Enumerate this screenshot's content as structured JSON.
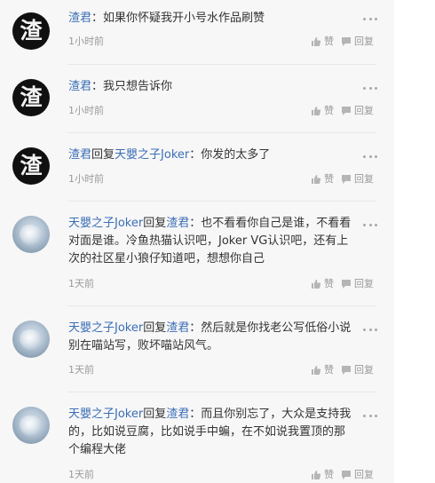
{
  "comments": [
    {
      "avatar_glyph": "渣",
      "author": "渣君",
      "reply_word": "",
      "reply_to": "",
      "separator": "：",
      "text": "如果你怀疑我开小号水作品刷赞",
      "time": "1小时前",
      "like": "赞",
      "reply": "回复",
      "avatar_style": "dark"
    },
    {
      "avatar_glyph": "渣",
      "author": "渣君",
      "reply_word": "",
      "reply_to": "",
      "separator": "：",
      "text": "我只想告诉你",
      "time": "1小时前",
      "like": "赞",
      "reply": "回复",
      "avatar_style": "dark"
    },
    {
      "avatar_glyph": "渣",
      "author": "渣君",
      "reply_word": "回复",
      "reply_to": "天嬰之子Joker",
      "separator": "：",
      "text": "你发的太多了",
      "time": "1小时前",
      "like": "赞",
      "reply": "回复",
      "avatar_style": "dark"
    },
    {
      "avatar_glyph": "",
      "author": "天嬰之子Joker",
      "reply_word": "回复",
      "reply_to": "渣君",
      "separator": "：",
      "text": "也不看看你自己是谁，不看看对面是谁。冷鱼热猫认识吧，Joker VG认识吧，还有上次的社区星小狼仔知道吧，想想你自己",
      "time": "1天前",
      "like": "赞",
      "reply": "回复",
      "avatar_style": "light"
    },
    {
      "avatar_glyph": "",
      "author": "天嬰之子Joker",
      "reply_word": "回复",
      "reply_to": "渣君",
      "separator": "：",
      "text": "然后就是你找老公写低俗小说别在喵站写，败坏喵站风气。",
      "time": "1天前",
      "like": "赞",
      "reply": "回复",
      "avatar_style": "light"
    },
    {
      "avatar_glyph": "",
      "author": "天嬰之子Joker",
      "reply_word": "回复",
      "reply_to": "渣君",
      "separator": "：",
      "text": "而且你别忘了，大众是支持我的，比如说豆腐，比如说手中蝙，在不如说我置顶的那个编程大佬",
      "time": "1天前",
      "like": "赞",
      "reply": "回复",
      "avatar_style": "light"
    }
  ],
  "icons": {
    "like": "thumbs-up-icon",
    "reply": "comment-bubble-icon",
    "more": "more-dots-icon"
  },
  "colors": {
    "author_link": "#3b6eb5",
    "meta": "#9a9a9a",
    "text": "#333333",
    "panel_bg": "#f7f7f7"
  }
}
